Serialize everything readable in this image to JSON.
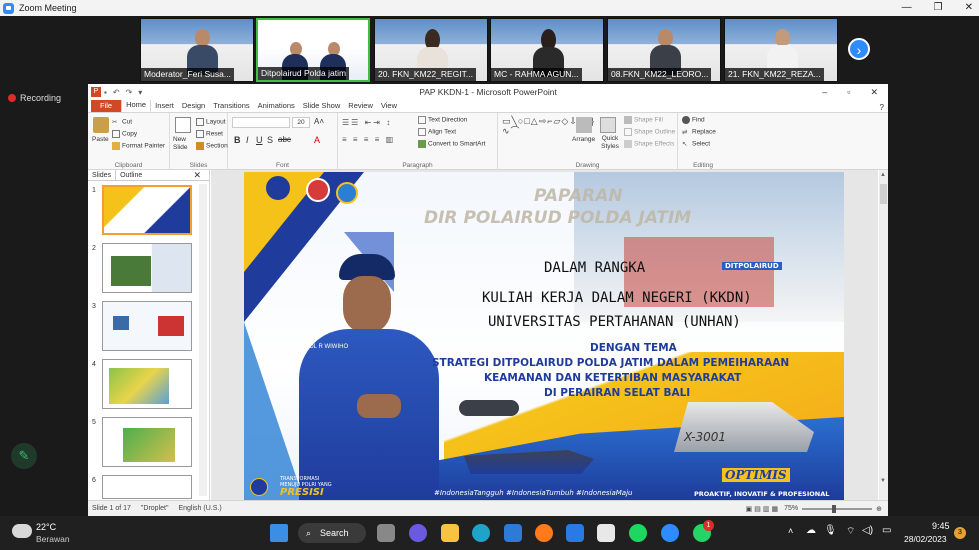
{
  "zoom": {
    "window_title": "Zoom Meeting",
    "recording_label": "Recording",
    "participants": [
      {
        "name": "Moderator_Feri Susa..."
      },
      {
        "name": "Ditpolairud Polda jatim"
      },
      {
        "name": "20. FKN_KM22_REGIT..."
      },
      {
        "name": "MC - RAHMA AGUN..."
      },
      {
        "name": "08.FKN_KM22_LEORO..."
      },
      {
        "name": "21. FKN_KM22_REZA..."
      }
    ]
  },
  "ppt": {
    "title": "PAP KKDN-1 - Microsoft PowerPoint",
    "tabs": [
      "File",
      "Home",
      "Insert",
      "Design",
      "Transitions",
      "Animations",
      "Slide Show",
      "Review",
      "View"
    ],
    "ribbon": {
      "clipboard": {
        "paste": "Paste",
        "cut": "Cut",
        "copy": "Copy",
        "format_painter": "Format Painter",
        "label": "Clipboard"
      },
      "slides": {
        "new_slide": "New Slide",
        "layout": "Layout",
        "reset": "Reset",
        "section": "Section",
        "label": "Slides"
      },
      "font": {
        "size": "20",
        "label": "Font"
      },
      "paragraph": {
        "text_direction": "Text Direction",
        "align_text": "Align Text",
        "convert": "Convert to SmartArt",
        "label": "Paragraph"
      },
      "drawing": {
        "arrange": "Arrange",
        "quick_styles": "Quick Styles",
        "shape_fill": "Shape Fill",
        "shape_outline": "Shape Outline",
        "shape_effects": "Shape Effects",
        "label": "Drawing"
      },
      "editing": {
        "find": "Find",
        "replace": "Replace",
        "select": "Select",
        "label": "Editing"
      }
    },
    "panel_tabs": [
      "Slides",
      "Outline"
    ],
    "thumb_numbers": [
      "1",
      "2",
      "3",
      "4",
      "5",
      "6"
    ],
    "status": {
      "slide": "Slide 1 of 17",
      "theme": "\"Droplet\"",
      "language": "English (U.S.)",
      "zoom": "75%"
    }
  },
  "slide": {
    "header1": "PAPARAN",
    "header2": "DIR POLAIRUD POLDA JATIM",
    "line1": "DALAM RANGKA",
    "line2": "KULIAH KERJA DALAM NEGERI (KKDN)",
    "line3": "UNIVERSITAS PERTAHANAN (UNHAN)",
    "theme_label": "DENGAN TEMA",
    "theme1": "STRATEGI DITPOLAIRUD POLDA JATIM DALAM PEMEIHARAAN",
    "theme2": "KEAMANAN DAN KETERTIBAN MASYARAKAT",
    "theme3": "DI PERAIRAN SELAT BALI",
    "building_sign": "DITPOLAIRUD",
    "boat_id": "X-3001",
    "footer_left1": "TRANSFORMASI",
    "footer_left2": "MENUJU POLRI YANG",
    "footer_left3": "PRESISI",
    "hashtags": "#IndonesiaTangguh #IndonesiaTumbuh #IndonesiaMaju",
    "optimis": "OPTIMIS",
    "footer_right": "PROAKTIF, INOVATIF & PROFESIONAL",
    "officer_badge": "POL R WIWIHO"
  },
  "taskbar": {
    "weather_temp": "22°C",
    "weather_desc": "Berawan",
    "search": "Search",
    "time": "9:45",
    "date": "28/02/2023",
    "notif_count": "3",
    "whatsapp_badge": "1"
  },
  "colors": {
    "zoom_blue": "#2d8cff",
    "ppt_orange": "#d24726",
    "slide_blue": "#1f3c9c",
    "slide_yellow": "#f5c21a"
  }
}
